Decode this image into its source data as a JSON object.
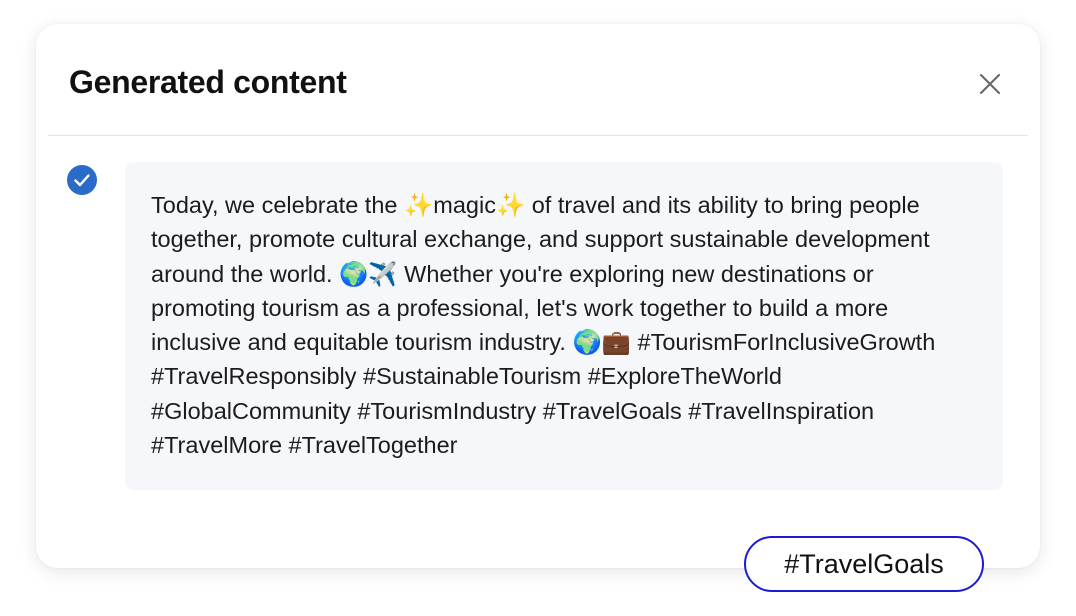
{
  "dialog": {
    "title": "Generated content",
    "close_icon": "close-icon",
    "content_text": "Today, we celebrate the ✨magic✨ of travel and its ability to bring people\ntogether, promote cultural exchange, and support sustainable development\naround the world. 🌍✈️ Whether you're exploring new destinations or\npromoting tourism as a professional, let's work together to build a more\ninclusive and equitable tourism industry. 🌍💼 #TourismForInclusiveGrowth\n#TravelResponsibly #SustainableTourism #ExploreTheWorld\n#GlobalCommunity #TourismIndustry #TravelGoals #TravelInspiration\n#TravelMore #TravelTogether",
    "selected_icon": "check-circle-icon"
  },
  "tag_chip": {
    "label": "#TravelGoals"
  },
  "colors": {
    "accent": "#2a6ac8",
    "chip_border": "#1b1bd6",
    "content_background": "#f6f7fb"
  }
}
